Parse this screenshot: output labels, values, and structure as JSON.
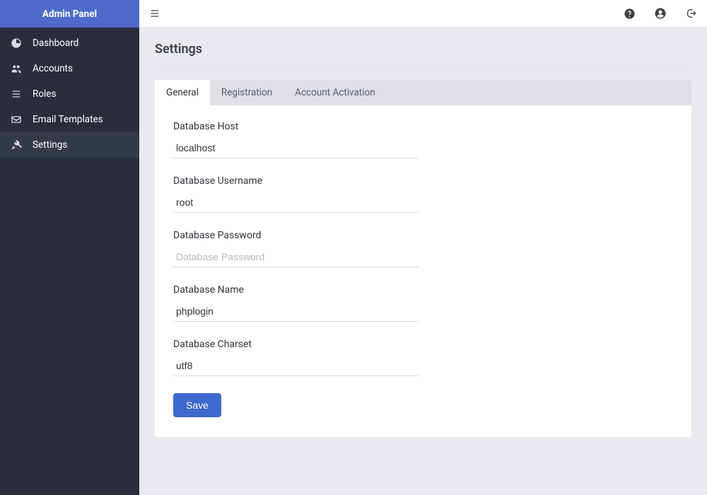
{
  "brand": "Admin Panel",
  "sidebar": {
    "items": [
      {
        "label": "Dashboard"
      },
      {
        "label": "Accounts"
      },
      {
        "label": "Roles"
      },
      {
        "label": "Email Templates"
      },
      {
        "label": "Settings"
      }
    ]
  },
  "page": {
    "title": "Settings"
  },
  "tabs": [
    {
      "label": "General"
    },
    {
      "label": "Registration"
    },
    {
      "label": "Account Activation"
    }
  ],
  "form": {
    "host": {
      "label": "Database Host",
      "value": "localhost"
    },
    "user": {
      "label": "Database Username",
      "value": "root"
    },
    "pass": {
      "label": "Database Password",
      "placeholder": "Database Password",
      "value": ""
    },
    "name": {
      "label": "Database Name",
      "value": "phplogin"
    },
    "charset": {
      "label": "Database Charset",
      "value": "utf8"
    },
    "save_label": "Save"
  }
}
